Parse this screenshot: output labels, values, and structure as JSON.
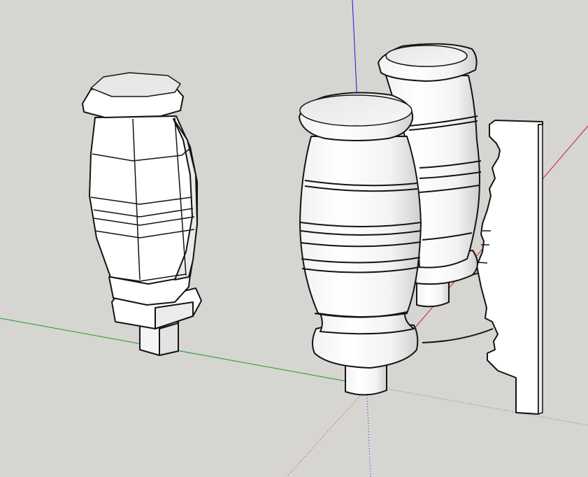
{
  "viewport": {
    "background": "#d6d5d2",
    "axes": {
      "red": "#c8202a",
      "green": "#1a9a1a",
      "blue": "#1a1ad0"
    },
    "model": {
      "fill": "#ffffff",
      "shade": "#e9e9e9",
      "edge": "#141414"
    },
    "objects": [
      "octagonal-baluster",
      "round-turned-baluster-front",
      "round-turned-baluster-back",
      "profile-cross-section",
      "lathe-revolve-path"
    ]
  }
}
